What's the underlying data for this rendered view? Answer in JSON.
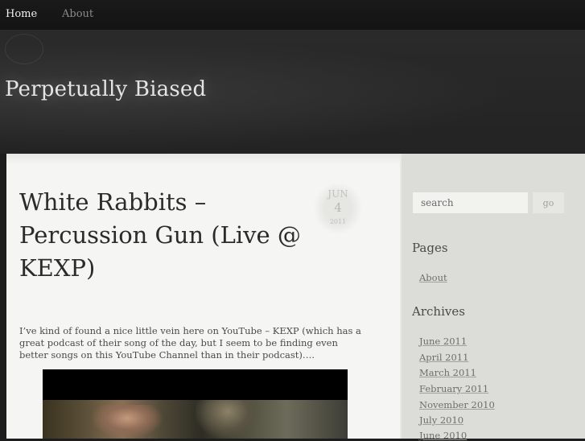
{
  "nav": {
    "items": [
      {
        "label": "Home"
      },
      {
        "label": "About"
      }
    ]
  },
  "header": {
    "site_title": "Perpetually Biased"
  },
  "post": {
    "title": "White Rabbits – Percussion Gun (Live @ KEXP)",
    "date": {
      "month": "JUN",
      "day": "4",
      "year": "2011"
    },
    "excerpt": "I’ve kind of found a nice little vein here on YouTube – KEXP (which has a great podcast of their song of the day, but I seem to be finding even better songs on this YouTube Channel than in their podcast)…."
  },
  "sidebar": {
    "search": {
      "placeholder": "search",
      "button_label": "go"
    },
    "pages": {
      "title": "Pages",
      "items": [
        {
          "label": "About"
        }
      ]
    },
    "archives": {
      "title": "Archives",
      "items": [
        {
          "label": "June 2011"
        },
        {
          "label": "April 2011"
        },
        {
          "label": "March 2011"
        },
        {
          "label": "February 2011"
        },
        {
          "label": "November 2010"
        },
        {
          "label": "July 2010"
        },
        {
          "label": "June 2010"
        }
      ]
    }
  },
  "colors": {
    "nav_bg": "#151515",
    "header_bg": "#262626",
    "content_bg": "#f5f6f3",
    "sidebar_bg": "#dcdcd8",
    "text_dark": "#2b2b2b"
  }
}
